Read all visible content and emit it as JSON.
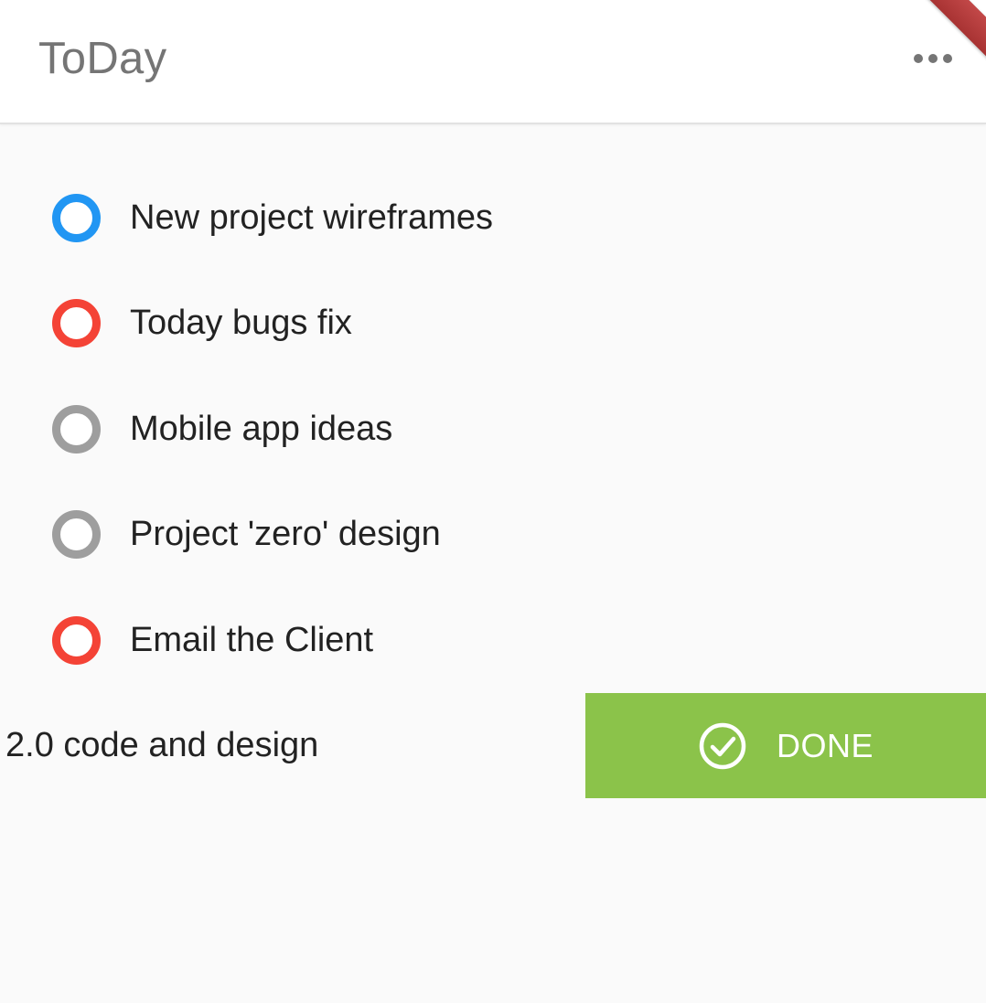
{
  "app": {
    "title": "ToDay"
  },
  "menu": {
    "icon": "more-horiz-icon"
  },
  "tasks": [
    {
      "label": "New project wireframes",
      "color": "#2196f3"
    },
    {
      "label": "Today bugs fix",
      "color": "#f44336"
    },
    {
      "label": "Mobile app ideas",
      "color": "#9e9e9e"
    },
    {
      "label": "Project 'zero' design",
      "color": "#9e9e9e"
    },
    {
      "label": "Email the Client",
      "color": "#f44336"
    }
  ],
  "swiped_task": {
    "label": "2.0 code and design",
    "action": {
      "label": "DONE",
      "icon": "check-circle-icon",
      "color": "#8bc34a"
    }
  },
  "colors": {
    "appbar_title": "#757575",
    "background": "#fafafa",
    "debug_banner": "#b03a3a"
  }
}
